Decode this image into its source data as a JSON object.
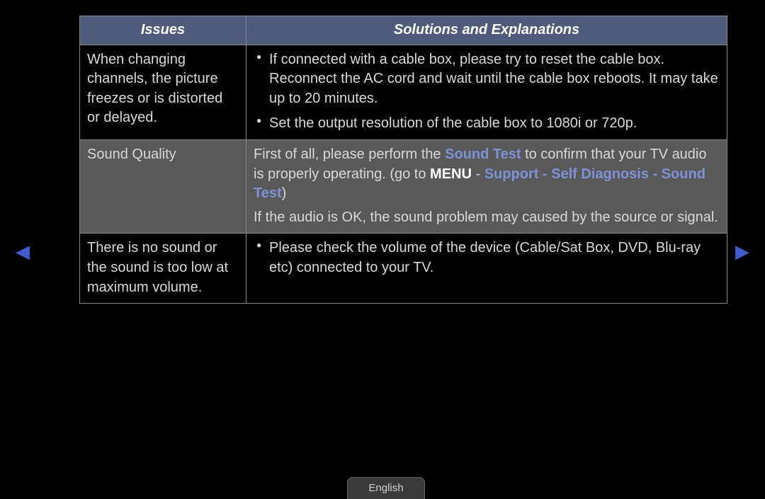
{
  "table": {
    "headers": {
      "issues": "Issues",
      "solutions": "Solutions and Explanations"
    },
    "row1": {
      "issue": "When changing channels, the picture freezes or is distorted or delayed.",
      "bullets": [
        "If connected with a cable box, please try to reset the cable box. Reconnect the AC cord and wait until the cable box reboots. It may take up to 20 minutes.",
        "Set the output resolution of the cable box to 1080i or 720p."
      ]
    },
    "row2": {
      "issue": "Sound Quality",
      "sol_part1": "First of all, please perform the ",
      "sol_sound_test": "Sound Test",
      "sol_part2": " to confirm that your TV audio is properly operating. (go to ",
      "sol_menu": "MENU",
      "sol_dash1": " - ",
      "sol_span_accent": "Support - Self Diagnosis - Sound Test",
      "sol_paren": ")",
      "sol_line2": "If the audio is OK, the sound problem may caused by the source or signal."
    },
    "row3": {
      "issue": "There is no sound or the sound is too low at maximum volume.",
      "bullets": [
        "Please check the volume of the device (Cable/Sat Box, DVD, Blu-ray etc) connected to your TV."
      ]
    }
  },
  "language": "English"
}
